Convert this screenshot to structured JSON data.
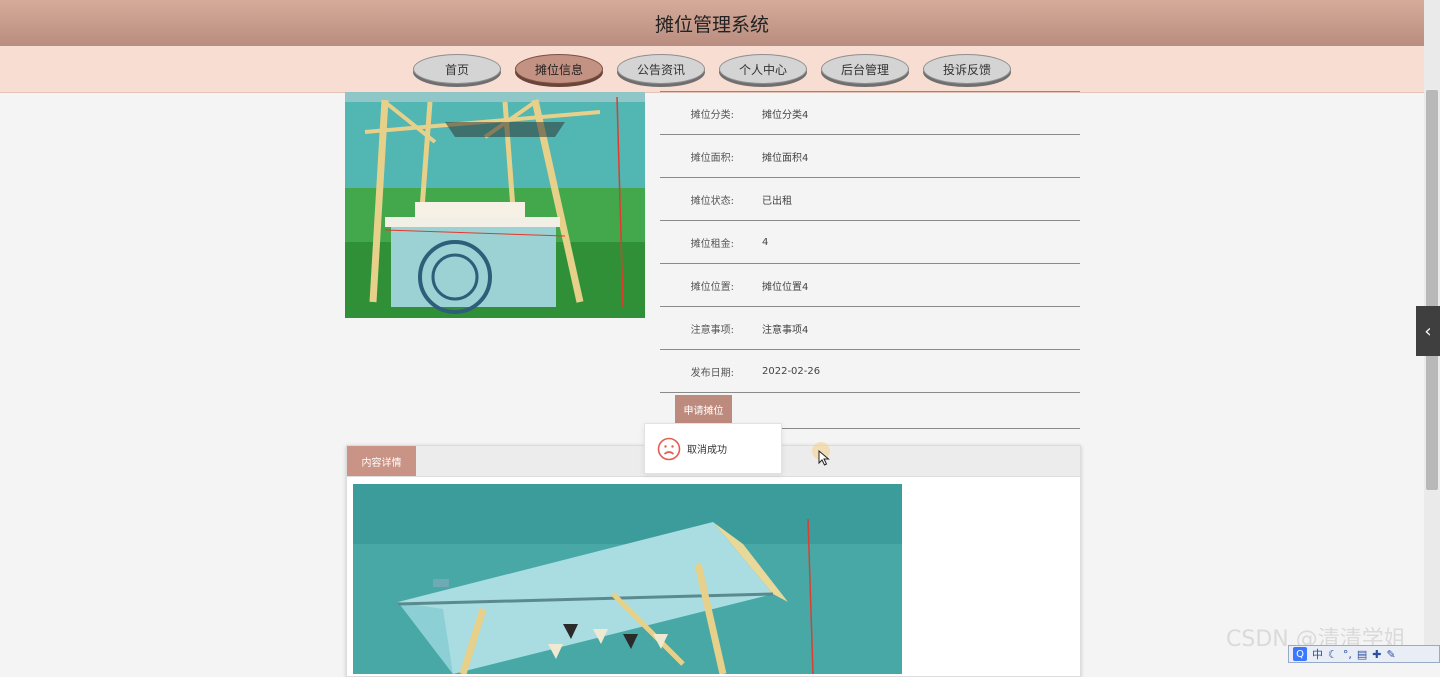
{
  "header": {
    "title": "摊位管理系统"
  },
  "nav": [
    {
      "label": "首页",
      "active": false
    },
    {
      "label": "摊位信息",
      "active": true
    },
    {
      "label": "公告资讯",
      "active": false
    },
    {
      "label": "个人中心",
      "active": false
    },
    {
      "label": "后台管理",
      "active": false
    },
    {
      "label": "投诉反馈",
      "active": false
    }
  ],
  "info": {
    "rows": [
      {
        "label": "摊位分类:",
        "value": "摊位分类4"
      },
      {
        "label": "摊位面积:",
        "value": "摊位面积4"
      },
      {
        "label": "摊位状态:",
        "value": "已出租"
      },
      {
        "label": "摊位租金:",
        "value": "4"
      },
      {
        "label": "摊位位置:",
        "value": "摊位位置4"
      },
      {
        "label": "注意事项:",
        "value": "注意事项4"
      },
      {
        "label": "发布日期:",
        "value": "2022-02-26"
      }
    ],
    "apply_button": "申请摊位"
  },
  "toast": {
    "text": "取消成功"
  },
  "detail": {
    "tab": "内容详情"
  },
  "watermark": "CSDN @清清学姐",
  "ime": {
    "logo": "Q",
    "mode": "中"
  },
  "colors": {
    "header": "#c89c8c",
    "nav": "#f8ddd3",
    "accent": "#bd8b7e"
  }
}
